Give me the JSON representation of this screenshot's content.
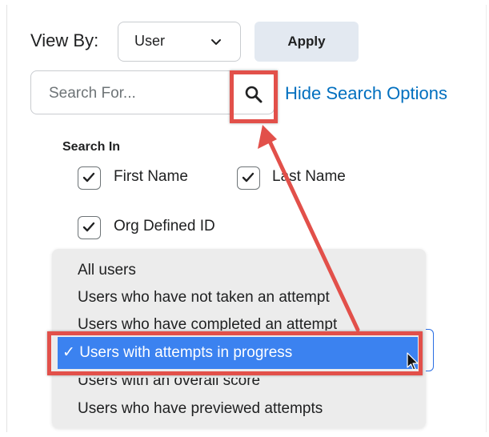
{
  "toolbar": {
    "view_by_label": "View By:",
    "view_by_value": "User",
    "apply_label": "Apply"
  },
  "search": {
    "placeholder": "Search For...",
    "hide_options_label": "Hide Search Options"
  },
  "search_in": {
    "heading": "Search In",
    "options": [
      {
        "label": "First Name",
        "checked": true
      },
      {
        "label": "Last Name",
        "checked": true
      },
      {
        "label": "Org Defined ID",
        "checked": true
      }
    ]
  },
  "dropdown": {
    "items": [
      "All users",
      "Users who have not taken an attempt",
      "Users who have completed an attempt",
      "Users with attempts in progress",
      "Users with an overall score",
      "Users who have previewed attempts"
    ],
    "selected_label": "✓ Users with attempts in progress",
    "selected_index": 3
  },
  "colors": {
    "link": "#006fbf",
    "highlight": "#e2504a",
    "selection": "#3b82f0",
    "apply_bg": "#e3e9f1"
  },
  "icons": [
    "chevron-down-icon",
    "search-icon",
    "checkmark-icon",
    "pointer-cursor-icon"
  ]
}
